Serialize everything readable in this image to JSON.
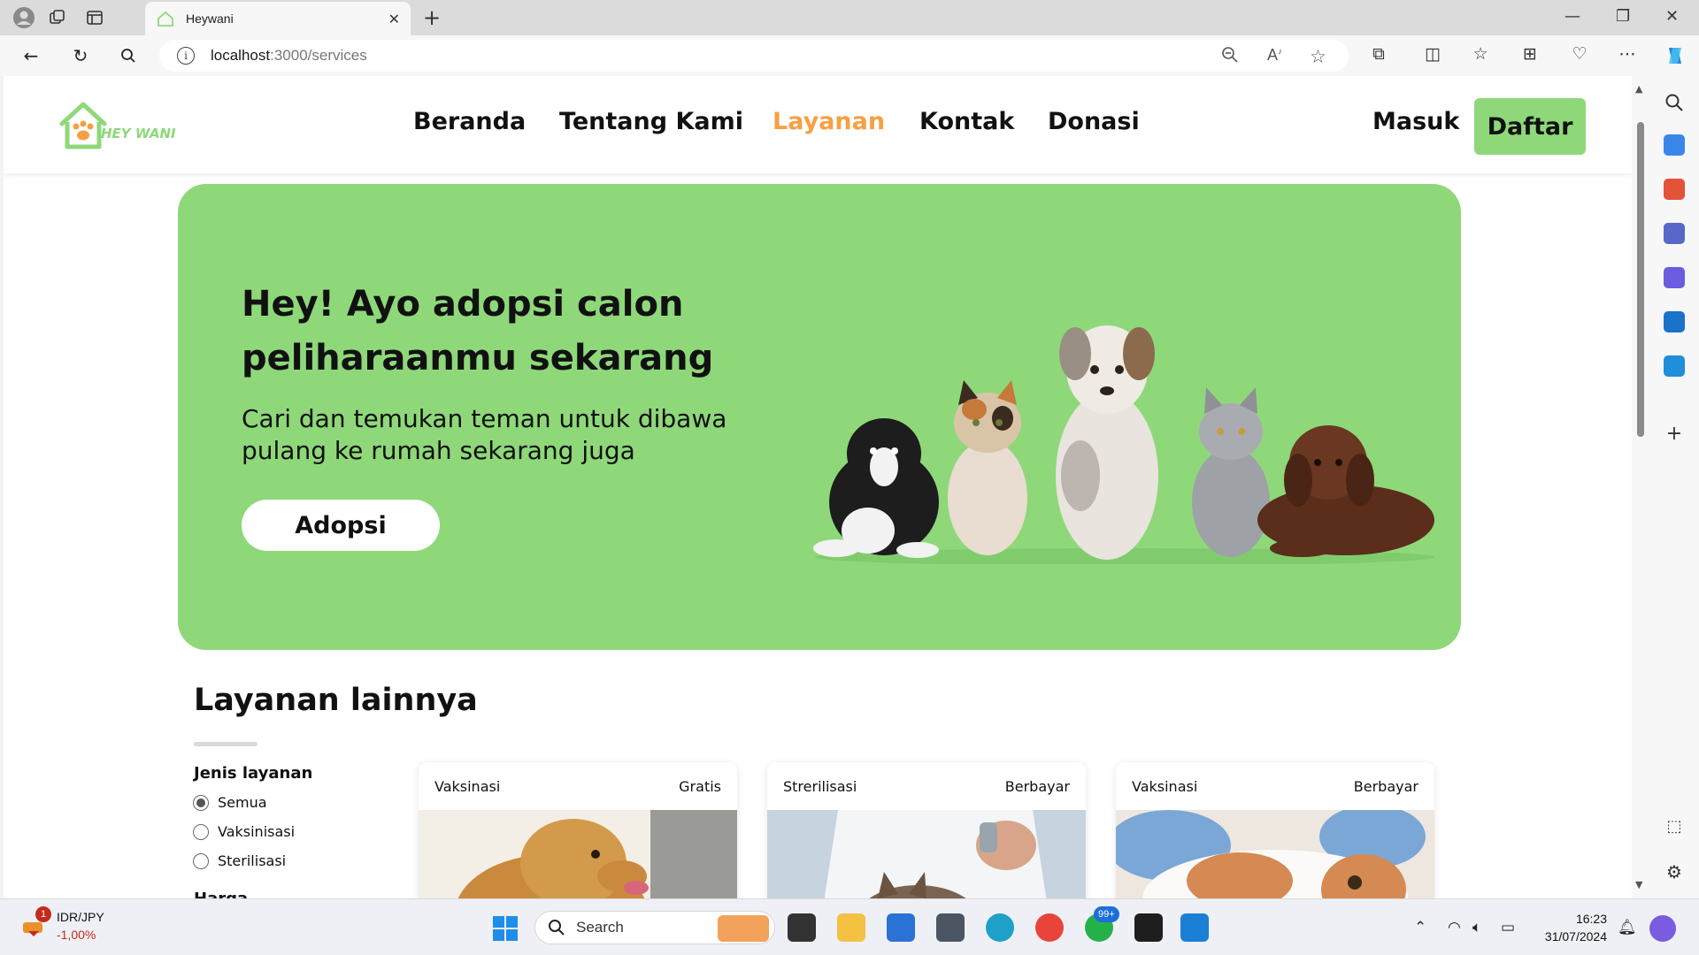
{
  "browser": {
    "tab_title": "Heywani",
    "url_host": "localhost",
    "url_path": ":3000/services"
  },
  "site": {
    "logo_text": "HEY WANI",
    "nav": [
      "Beranda",
      "Tentang Kami",
      "Layanan",
      "Kontak",
      "Donasi"
    ],
    "active_nav": "Layanan",
    "login_label": "Masuk",
    "register_label": "Daftar",
    "accent_color": "#8ed87a",
    "active_color": "#f7a043"
  },
  "hero": {
    "title": "Hey! Ayo adopsi calon peliharaanmu sekarang",
    "subtitle": "Cari dan temukan teman untuk dibawa pulang ke rumah sekarang juga",
    "button_label": "Adopsi"
  },
  "services": {
    "section_title": "Layanan lainnya",
    "filter_title": "Jenis layanan",
    "filter_options": [
      "Semua",
      "Vaksinisasi",
      "Sterilisasi"
    ],
    "selected_filter": "Semua",
    "next_filter_title": "Harga",
    "cards": [
      {
        "type": "Vaksinasi",
        "price": "Gratis"
      },
      {
        "type": "Strerilisasi",
        "price": "Berbayar"
      },
      {
        "type": "Vaksinasi",
        "price": "Berbayar"
      }
    ]
  },
  "taskbar": {
    "ticker_name": "IDR/JPY",
    "ticker_value": "-1,00%",
    "ticker_badge": "1",
    "search_placeholder": "Search",
    "whatsapp_badge": "99+",
    "time": "16:23",
    "date": "31/07/2024"
  }
}
